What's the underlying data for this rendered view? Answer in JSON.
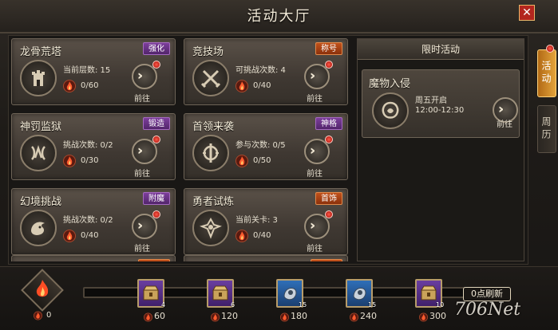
{
  "window": {
    "title": "活动大厅",
    "close_label": "✕"
  },
  "activities": [
    {
      "name": "龙骨荒塔",
      "tag": "强化",
      "tag_color": "purple",
      "info": "当前层数: 15",
      "count": "0/60",
      "go": "前往",
      "icon": "tower-icon"
    },
    {
      "name": "竞技场",
      "tag": "称号",
      "tag_color": "orange",
      "info": "可挑战次数: 4",
      "count": "0/40",
      "go": "前往",
      "icon": "crossed-swords-icon"
    },
    {
      "name": "神罚监狱",
      "tag": "锻造",
      "tag_color": "purple",
      "info": "挑战次数: 0/2",
      "count": "0/30",
      "go": "前往",
      "icon": "prison-icon"
    },
    {
      "name": "首领来袭",
      "tag": "神格",
      "tag_color": "purple",
      "info": "参与次数: 0/5",
      "count": "0/50",
      "go": "前往",
      "icon": "boss-icon"
    },
    {
      "name": "幻境挑战",
      "tag": "附魔",
      "tag_color": "purple",
      "info": "挑战次数: 0/2",
      "count": "0/40",
      "go": "前往",
      "icon": "dragon-icon"
    },
    {
      "name": "勇者试炼",
      "tag": "首饰",
      "tag_color": "orange",
      "info": "当前关卡: 3",
      "count": "0/40",
      "go": "前往",
      "icon": "trial-icon"
    }
  ],
  "limited": {
    "header": "限时活动",
    "event": {
      "name": "魔物入侵",
      "schedule": "周五开启",
      "time": "12:00-12:30",
      "go": "前往",
      "icon": "monster-icon"
    }
  },
  "tabs": [
    {
      "label": "活动",
      "active": true
    },
    {
      "label": "周历",
      "active": false
    }
  ],
  "rewards": {
    "current_score": "0",
    "refresh_label": "0点刷新",
    "progress": 0,
    "milestones": [
      {
        "score": "60",
        "qty": "4",
        "chest": "purple"
      },
      {
        "score": "120",
        "qty": "6",
        "chest": "purple"
      },
      {
        "score": "180",
        "qty": "15",
        "chest": "blue"
      },
      {
        "score": "240",
        "qty": "15",
        "chest": "blue"
      },
      {
        "score": "300",
        "qty": "10",
        "chest": "purple"
      }
    ]
  },
  "watermark": "706Net",
  "colors": {
    "accent": "#e3a33b",
    "alert": "#d8261b",
    "tag_purple": "#6a3185",
    "tag_orange": "#b0461a"
  }
}
